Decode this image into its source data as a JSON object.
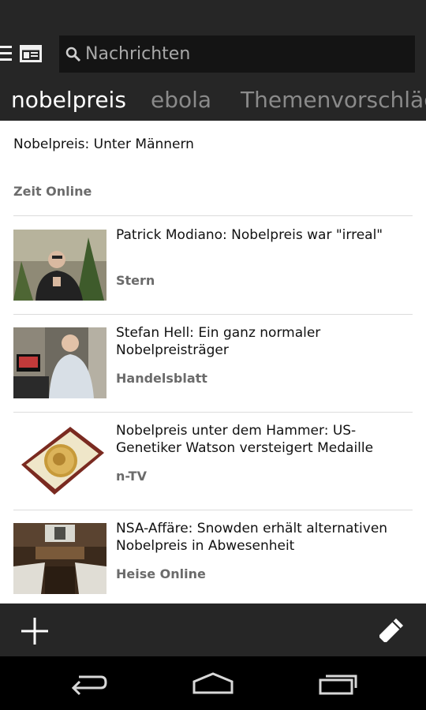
{
  "search": {
    "placeholder": "Nachrichten"
  },
  "tabs": [
    {
      "label": "nobelpreis",
      "active": true
    },
    {
      "label": "ebola",
      "active": false
    },
    {
      "label": "Themenvorschläge",
      "active": false
    }
  ],
  "top_article": {
    "title": "Nobelpreis: Unter Männern",
    "source": "Zeit Online"
  },
  "articles": [
    {
      "title": "Patrick Modiano: Nobelpreis war \"irreal\"",
      "source": "Stern",
      "thumbnail": "portrait-photo"
    },
    {
      "title": "Stefan Hell: Ein ganz normaler Nobelpreisträger",
      "source": "Handelsblatt",
      "thumbnail": "lab-photo"
    },
    {
      "title": "Nobelpreis unter dem Hammer: US-Genetiker Watson versteigert Medaille",
      "source": "n-TV",
      "thumbnail": "medal-photo"
    },
    {
      "title": "NSA-Affäre: Snowden erhält alternativen Nobelpreis in Abwesenheit",
      "source": "Heise Online",
      "thumbnail": "hall-photo"
    }
  ],
  "icons": {
    "menu": "menu-icon",
    "news": "newspaper-icon",
    "search": "search-icon",
    "add": "plus-icon",
    "edit": "pencil-icon",
    "back": "back-icon",
    "home": "home-icon",
    "recents": "recents-icon"
  },
  "colors": {
    "bar": "#262626",
    "search_bg": "#141414",
    "active_tab": "#ffffff",
    "inactive_tab": "#8a8a8a"
  }
}
